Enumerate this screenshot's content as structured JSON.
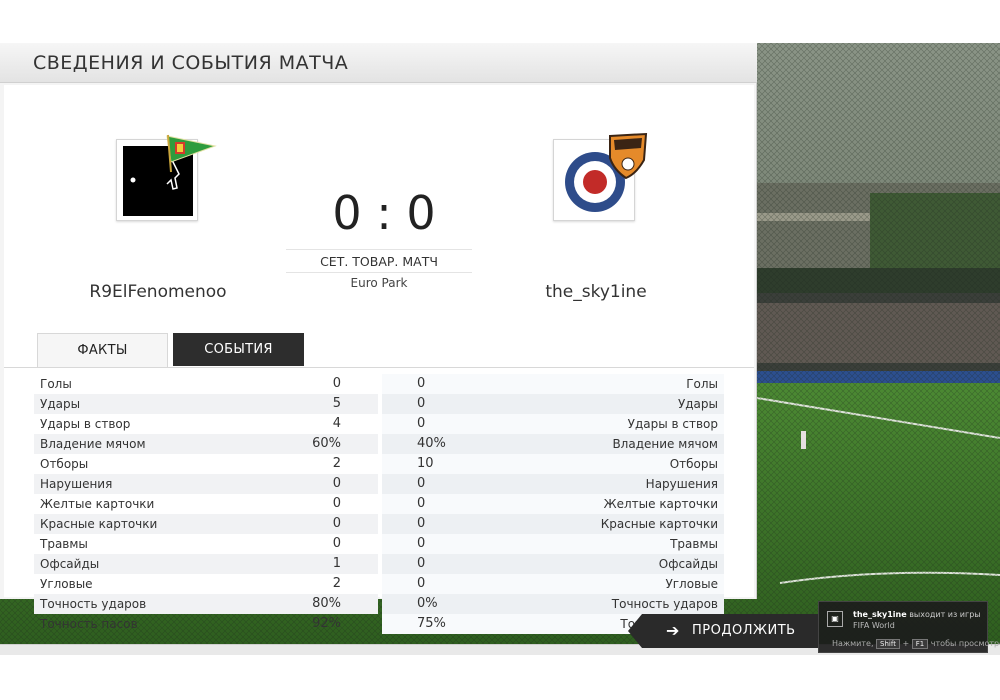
{
  "header": {
    "title": "СВЕДЕНИЯ И СОБЫТИЯ МАТЧА"
  },
  "match": {
    "home_team": "R9ElFenomenoo",
    "away_team": "the_sky1ine",
    "score": "0 : 0",
    "type": "СЕТ. ТОВАР. МАТЧ",
    "stadium": "Euro Park"
  },
  "tabs": [
    {
      "label": "ФАКТЫ",
      "active": true
    },
    {
      "label": "СОБЫТИЯ",
      "active": false
    }
  ],
  "stats": [
    {
      "label": "Голы",
      "home": "0",
      "away": "0"
    },
    {
      "label": "Удары",
      "home": "5",
      "away": "0"
    },
    {
      "label": "Удары в створ",
      "home": "4",
      "away": "0"
    },
    {
      "label": "Владение мячом",
      "home": "60%",
      "away": "40%"
    },
    {
      "label": "Отборы",
      "home": "2",
      "away": "10"
    },
    {
      "label": "Нарушения",
      "home": "0",
      "away": "0"
    },
    {
      "label": "Желтые карточки",
      "home": "0",
      "away": "0"
    },
    {
      "label": "Красные карточки",
      "home": "0",
      "away": "0"
    },
    {
      "label": "Травмы",
      "home": "0",
      "away": "0"
    },
    {
      "label": "Офсайды",
      "home": "1",
      "away": "0"
    },
    {
      "label": "Угловые",
      "home": "2",
      "away": "0"
    },
    {
      "label": "Точность ударов",
      "home": "80%",
      "away": "0%"
    },
    {
      "label": "Точность пасов",
      "home": "92%",
      "away": "75%"
    }
  ],
  "continue": {
    "label": "ПРОДОЛЖИТЬ"
  },
  "notification": {
    "user": "the_sky1ine",
    "message": " выходит из игры",
    "service": "FIFA World",
    "hint_prefix": "Нажмите,",
    "key1": "Shift",
    "plus": "+",
    "key2": "F1",
    "hint_suffix": "чтобы просмотреть"
  },
  "icons": {
    "continue": "arrow-right-icon",
    "notification": "fifa-world-icon",
    "home_crest": "flag-crest-icon",
    "away_crest": "target-crest-icon"
  },
  "colors": {
    "panel_bg": "#f4f4f4",
    "dark_tab": "#2d2d2d",
    "pitch": "#3f7a2c"
  }
}
